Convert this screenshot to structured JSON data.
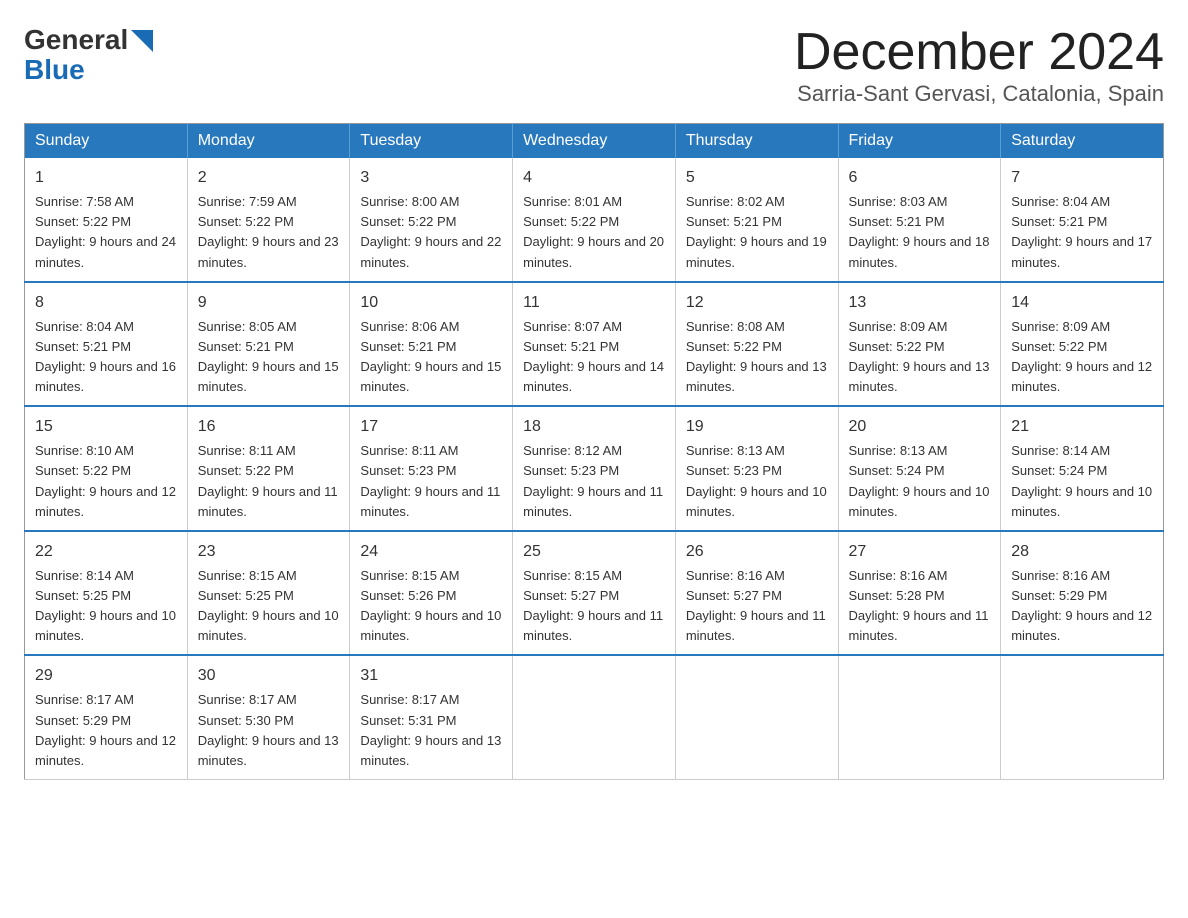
{
  "header": {
    "logo_general": "General",
    "logo_blue": "Blue",
    "month_title": "December 2024",
    "location": "Sarria-Sant Gervasi, Catalonia, Spain"
  },
  "weekdays": [
    "Sunday",
    "Monday",
    "Tuesday",
    "Wednesday",
    "Thursday",
    "Friday",
    "Saturday"
  ],
  "weeks": [
    [
      {
        "day": "1",
        "sunrise": "7:58 AM",
        "sunset": "5:22 PM",
        "daylight": "9 hours and 24 minutes."
      },
      {
        "day": "2",
        "sunrise": "7:59 AM",
        "sunset": "5:22 PM",
        "daylight": "9 hours and 23 minutes."
      },
      {
        "day": "3",
        "sunrise": "8:00 AM",
        "sunset": "5:22 PM",
        "daylight": "9 hours and 22 minutes."
      },
      {
        "day": "4",
        "sunrise": "8:01 AM",
        "sunset": "5:22 PM",
        "daylight": "9 hours and 20 minutes."
      },
      {
        "day": "5",
        "sunrise": "8:02 AM",
        "sunset": "5:21 PM",
        "daylight": "9 hours and 19 minutes."
      },
      {
        "day": "6",
        "sunrise": "8:03 AM",
        "sunset": "5:21 PM",
        "daylight": "9 hours and 18 minutes."
      },
      {
        "day": "7",
        "sunrise": "8:04 AM",
        "sunset": "5:21 PM",
        "daylight": "9 hours and 17 minutes."
      }
    ],
    [
      {
        "day": "8",
        "sunrise": "8:04 AM",
        "sunset": "5:21 PM",
        "daylight": "9 hours and 16 minutes."
      },
      {
        "day": "9",
        "sunrise": "8:05 AM",
        "sunset": "5:21 PM",
        "daylight": "9 hours and 15 minutes."
      },
      {
        "day": "10",
        "sunrise": "8:06 AM",
        "sunset": "5:21 PM",
        "daylight": "9 hours and 15 minutes."
      },
      {
        "day": "11",
        "sunrise": "8:07 AM",
        "sunset": "5:21 PM",
        "daylight": "9 hours and 14 minutes."
      },
      {
        "day": "12",
        "sunrise": "8:08 AM",
        "sunset": "5:22 PM",
        "daylight": "9 hours and 13 minutes."
      },
      {
        "day": "13",
        "sunrise": "8:09 AM",
        "sunset": "5:22 PM",
        "daylight": "9 hours and 13 minutes."
      },
      {
        "day": "14",
        "sunrise": "8:09 AM",
        "sunset": "5:22 PM",
        "daylight": "9 hours and 12 minutes."
      }
    ],
    [
      {
        "day": "15",
        "sunrise": "8:10 AM",
        "sunset": "5:22 PM",
        "daylight": "9 hours and 12 minutes."
      },
      {
        "day": "16",
        "sunrise": "8:11 AM",
        "sunset": "5:22 PM",
        "daylight": "9 hours and 11 minutes."
      },
      {
        "day": "17",
        "sunrise": "8:11 AM",
        "sunset": "5:23 PM",
        "daylight": "9 hours and 11 minutes."
      },
      {
        "day": "18",
        "sunrise": "8:12 AM",
        "sunset": "5:23 PM",
        "daylight": "9 hours and 11 minutes."
      },
      {
        "day": "19",
        "sunrise": "8:13 AM",
        "sunset": "5:23 PM",
        "daylight": "9 hours and 10 minutes."
      },
      {
        "day": "20",
        "sunrise": "8:13 AM",
        "sunset": "5:24 PM",
        "daylight": "9 hours and 10 minutes."
      },
      {
        "day": "21",
        "sunrise": "8:14 AM",
        "sunset": "5:24 PM",
        "daylight": "9 hours and 10 minutes."
      }
    ],
    [
      {
        "day": "22",
        "sunrise": "8:14 AM",
        "sunset": "5:25 PM",
        "daylight": "9 hours and 10 minutes."
      },
      {
        "day": "23",
        "sunrise": "8:15 AM",
        "sunset": "5:25 PM",
        "daylight": "9 hours and 10 minutes."
      },
      {
        "day": "24",
        "sunrise": "8:15 AM",
        "sunset": "5:26 PM",
        "daylight": "9 hours and 10 minutes."
      },
      {
        "day": "25",
        "sunrise": "8:15 AM",
        "sunset": "5:27 PM",
        "daylight": "9 hours and 11 minutes."
      },
      {
        "day": "26",
        "sunrise": "8:16 AM",
        "sunset": "5:27 PM",
        "daylight": "9 hours and 11 minutes."
      },
      {
        "day": "27",
        "sunrise": "8:16 AM",
        "sunset": "5:28 PM",
        "daylight": "9 hours and 11 minutes."
      },
      {
        "day": "28",
        "sunrise": "8:16 AM",
        "sunset": "5:29 PM",
        "daylight": "9 hours and 12 minutes."
      }
    ],
    [
      {
        "day": "29",
        "sunrise": "8:17 AM",
        "sunset": "5:29 PM",
        "daylight": "9 hours and 12 minutes."
      },
      {
        "day": "30",
        "sunrise": "8:17 AM",
        "sunset": "5:30 PM",
        "daylight": "9 hours and 13 minutes."
      },
      {
        "day": "31",
        "sunrise": "8:17 AM",
        "sunset": "5:31 PM",
        "daylight": "9 hours and 13 minutes."
      },
      null,
      null,
      null,
      null
    ]
  ]
}
